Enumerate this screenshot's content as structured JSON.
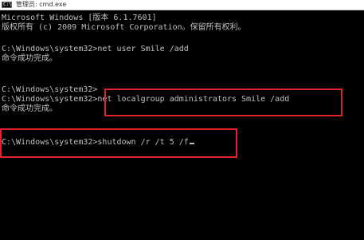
{
  "window": {
    "app_icon_label": "C:\\",
    "title": "管理员: cmd.exe"
  },
  "console": {
    "lines": [
      "Microsoft Windows [版本 6.1.7601]",
      "版权所有 (c) 2009 Microsoft Corporation。保留所有权利。",
      "C:\\Windows\\system32>net user Smile /add",
      "命令成功完成。",
      "C:\\Windows\\system32>",
      "C:\\Windows\\system32>net localgroup administrators Smile /add",
      "命令成功完成。",
      "C:\\Windows\\system32>shutdown /r /t 5 /f"
    ]
  },
  "annotations": {
    "highlight_color": "#e0242c"
  }
}
